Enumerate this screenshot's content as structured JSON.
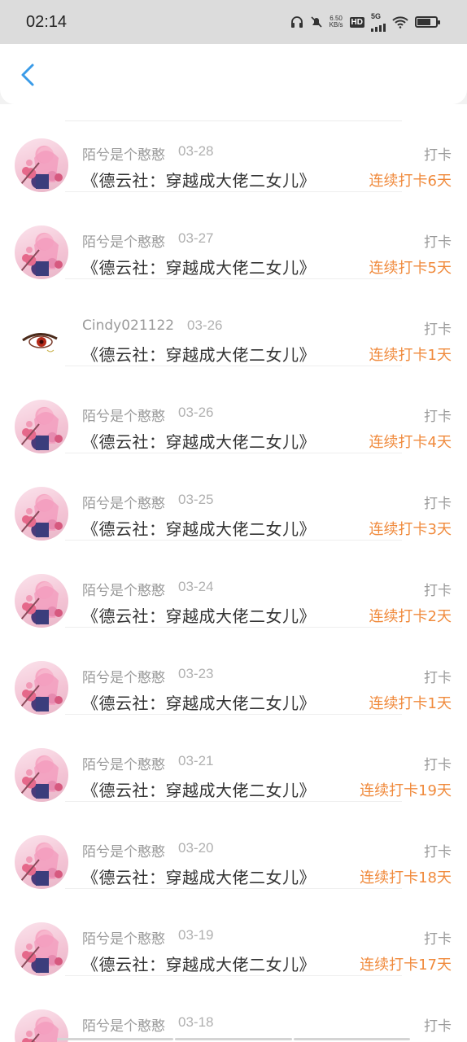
{
  "status_bar": {
    "time": "02:14",
    "net_speed_value": "6.50",
    "net_speed_unit": "KB/s",
    "hd": "HD",
    "network": "5G"
  },
  "header": {
    "back_icon": "chevron-left-icon"
  },
  "items": [
    {
      "user": "陌兮是个憨憨",
      "date": "03-28",
      "title": "《德云社：穿越成大佬二女儿》",
      "action": "打卡",
      "streak": "连续打卡6天",
      "avatar": "girl"
    },
    {
      "user": "陌兮是个憨憨",
      "date": "03-27",
      "title": "《德云社：穿越成大佬二女儿》",
      "action": "打卡",
      "streak": "连续打卡5天",
      "avatar": "girl"
    },
    {
      "user": "Cindy021122",
      "date": "03-26",
      "title": "《德云社：穿越成大佬二女儿》",
      "action": "打卡",
      "streak": "连续打卡1天",
      "avatar": "eye"
    },
    {
      "user": "陌兮是个憨憨",
      "date": "03-26",
      "title": "《德云社：穿越成大佬二女儿》",
      "action": "打卡",
      "streak": "连续打卡4天",
      "avatar": "girl"
    },
    {
      "user": "陌兮是个憨憨",
      "date": "03-25",
      "title": "《德云社：穿越成大佬二女儿》",
      "action": "打卡",
      "streak": "连续打卡3天",
      "avatar": "girl"
    },
    {
      "user": "陌兮是个憨憨",
      "date": "03-24",
      "title": "《德云社：穿越成大佬二女儿》",
      "action": "打卡",
      "streak": "连续打卡2天",
      "avatar": "girl"
    },
    {
      "user": "陌兮是个憨憨",
      "date": "03-23",
      "title": "《德云社：穿越成大佬二女儿》",
      "action": "打卡",
      "streak": "连续打卡1天",
      "avatar": "girl"
    },
    {
      "user": "陌兮是个憨憨",
      "date": "03-21",
      "title": "《德云社：穿越成大佬二女儿》",
      "action": "打卡",
      "streak": "连续打卡19天",
      "avatar": "girl"
    },
    {
      "user": "陌兮是个憨憨",
      "date": "03-20",
      "title": "《德云社：穿越成大佬二女儿》",
      "action": "打卡",
      "streak": "连续打卡18天",
      "avatar": "girl"
    },
    {
      "user": "陌兮是个憨憨",
      "date": "03-19",
      "title": "《德云社：穿越成大佬二女儿》",
      "action": "打卡",
      "streak": "连续打卡17天",
      "avatar": "girl"
    },
    {
      "user": "陌兮是个憨憨",
      "date": "03-18",
      "title": "",
      "action": "打卡",
      "streak": "",
      "avatar": "girl"
    }
  ],
  "colors": {
    "streak": "#f08a3c",
    "accent": "#3a9be8"
  }
}
